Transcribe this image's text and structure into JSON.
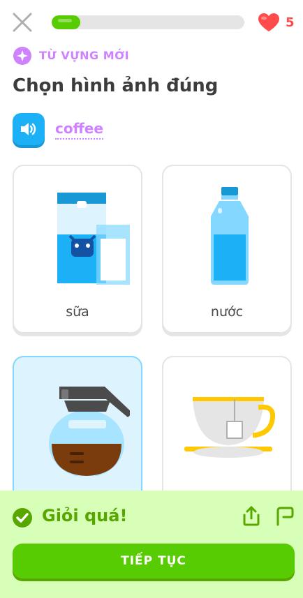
{
  "header": {
    "progress_value": 0.15,
    "hearts_count": "5"
  },
  "lesson": {
    "badge_label": "TỪ VỰNG MỚI",
    "title": "Chọn hình ảnh đúng",
    "word": "coffee"
  },
  "options": [
    {
      "label": "sữa",
      "icon": "milk-icon"
    },
    {
      "label": "nước",
      "icon": "water-bottle-icon"
    },
    {
      "label": "",
      "icon": "coffee-pot-icon",
      "selected": true
    },
    {
      "label": "",
      "icon": "tea-cup-icon"
    }
  ],
  "feedback": {
    "message": "Giỏi quá!",
    "continue_label": "TIẾP TỤC"
  },
  "colors": {
    "green": "#58cc02",
    "purple": "#ce82ff",
    "blue": "#1cb0f6",
    "red": "#ff4b4b",
    "feedback_bg": "#d7ffb8"
  }
}
